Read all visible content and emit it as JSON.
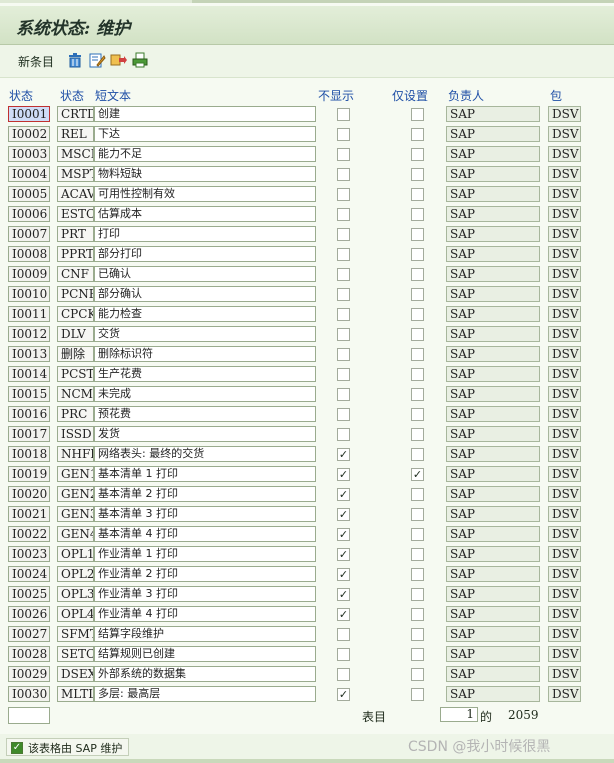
{
  "window": {
    "title": "系统状态: 维护"
  },
  "toolbar": {
    "new_entries_label": "新条目",
    "icons": [
      "trash-icon",
      "edit-icon",
      "transport-icon",
      "print-icon"
    ]
  },
  "columns": {
    "status": "状态",
    "status_code": "状态",
    "short_text": "短文本",
    "hide": "不显示",
    "set_only": "仅设置",
    "owner": "负责人",
    "package": "包"
  },
  "rows": [
    {
      "id": "I0001",
      "code": "CRTD",
      "text": "创建",
      "hide": false,
      "set": false,
      "owner": "SAP",
      "pkg": "DSV"
    },
    {
      "id": "I0002",
      "code": "REL",
      "text": "下达",
      "hide": false,
      "set": false,
      "owner": "SAP",
      "pkg": "DSV"
    },
    {
      "id": "I0003",
      "code": "MSCP",
      "text": "能力不足",
      "hide": false,
      "set": false,
      "owner": "SAP",
      "pkg": "DSV"
    },
    {
      "id": "I0004",
      "code": "MSPT",
      "text": "物料短缺",
      "hide": false,
      "set": false,
      "owner": "SAP",
      "pkg": "DSV"
    },
    {
      "id": "I0005",
      "code": "ACAV",
      "text": "可用性控制有效",
      "hide": false,
      "set": false,
      "owner": "SAP",
      "pkg": "DSV"
    },
    {
      "id": "I0006",
      "code": "ESTC",
      "text": "估算成本",
      "hide": false,
      "set": false,
      "owner": "SAP",
      "pkg": "DSV"
    },
    {
      "id": "I0007",
      "code": "PRT",
      "text": "打印",
      "hide": false,
      "set": false,
      "owner": "SAP",
      "pkg": "DSV"
    },
    {
      "id": "I0008",
      "code": "PPRT",
      "text": "部分打印",
      "hide": false,
      "set": false,
      "owner": "SAP",
      "pkg": "DSV"
    },
    {
      "id": "I0009",
      "code": "CNF",
      "text": "已确认",
      "hide": false,
      "set": false,
      "owner": "SAP",
      "pkg": "DSV"
    },
    {
      "id": "I0010",
      "code": "PCNF",
      "text": "部分确认",
      "hide": false,
      "set": false,
      "owner": "SAP",
      "pkg": "DSV"
    },
    {
      "id": "I0011",
      "code": "CPCK",
      "text": "能力检查",
      "hide": false,
      "set": false,
      "owner": "SAP",
      "pkg": "DSV"
    },
    {
      "id": "I0012",
      "code": "DLV",
      "text": "交货",
      "hide": false,
      "set": false,
      "owner": "SAP",
      "pkg": "DSV"
    },
    {
      "id": "I0013",
      "code": "删除",
      "text": "删除标识符",
      "hide": false,
      "set": false,
      "owner": "SAP",
      "pkg": "DSV"
    },
    {
      "id": "I0014",
      "code": "PCST",
      "text": "生产花费",
      "hide": false,
      "set": false,
      "owner": "SAP",
      "pkg": "DSV"
    },
    {
      "id": "I0015",
      "code": "NCMP",
      "text": "未完成",
      "hide": false,
      "set": false,
      "owner": "SAP",
      "pkg": "DSV"
    },
    {
      "id": "I0016",
      "code": "PRC",
      "text": "预花费",
      "hide": false,
      "set": false,
      "owner": "SAP",
      "pkg": "DSV"
    },
    {
      "id": "I0017",
      "code": "ISSD",
      "text": "发货",
      "hide": false,
      "set": false,
      "owner": "SAP",
      "pkg": "DSV"
    },
    {
      "id": "I0018",
      "code": "NHFD",
      "text": "网络表头: 最终的交货",
      "hide": true,
      "set": false,
      "owner": "SAP",
      "pkg": "DSV"
    },
    {
      "id": "I0019",
      "code": "GEN1",
      "text": "基本清单 1 打印",
      "hide": true,
      "set": true,
      "owner": "SAP",
      "pkg": "DSV"
    },
    {
      "id": "I0020",
      "code": "GEN2",
      "text": "基本清单 2 打印",
      "hide": true,
      "set": false,
      "owner": "SAP",
      "pkg": "DSV"
    },
    {
      "id": "I0021",
      "code": "GEN3",
      "text": "基本清单 3 打印",
      "hide": true,
      "set": false,
      "owner": "SAP",
      "pkg": "DSV"
    },
    {
      "id": "I0022",
      "code": "GEN4",
      "text": "基本清单 4 打印",
      "hide": true,
      "set": false,
      "owner": "SAP",
      "pkg": "DSV"
    },
    {
      "id": "I0023",
      "code": "OPL1",
      "text": "作业清单 1 打印",
      "hide": true,
      "set": false,
      "owner": "SAP",
      "pkg": "DSV"
    },
    {
      "id": "I0024",
      "code": "OPL2",
      "text": "作业清单 2 打印",
      "hide": true,
      "set": false,
      "owner": "SAP",
      "pkg": "DSV"
    },
    {
      "id": "I0025",
      "code": "OPL3",
      "text": "作业清单 3 打印",
      "hide": true,
      "set": false,
      "owner": "SAP",
      "pkg": "DSV"
    },
    {
      "id": "I0026",
      "code": "OPL4",
      "text": "作业清单 4 打印",
      "hide": true,
      "set": false,
      "owner": "SAP",
      "pkg": "DSV"
    },
    {
      "id": "I0027",
      "code": "SFMT",
      "text": "结算字段维护",
      "hide": false,
      "set": false,
      "owner": "SAP",
      "pkg": "DSV"
    },
    {
      "id": "I0028",
      "code": "SETC",
      "text": "结算规则已创建",
      "hide": false,
      "set": false,
      "owner": "SAP",
      "pkg": "DSV"
    },
    {
      "id": "I0029",
      "code": "DSEX",
      "text": "外部系统的数据集",
      "hide": false,
      "set": false,
      "owner": "SAP",
      "pkg": "DSV"
    },
    {
      "id": "I0030",
      "code": "MLTL",
      "text": "多层: 最高层",
      "hide": true,
      "set": false,
      "owner": "SAP",
      "pkg": "DSV"
    }
  ],
  "footer": {
    "entries_label": "表目",
    "page_value": "1",
    "of_label": "的",
    "total": "2059"
  },
  "maintenance": {
    "checked": true,
    "label": "该表格由 SAP 维护"
  },
  "watermark": "CSDN @我小时候很黑",
  "colors": {
    "header_text": "#1f4fa6",
    "background": "#f6faf2",
    "selected_cell": "#cfdcf7"
  }
}
